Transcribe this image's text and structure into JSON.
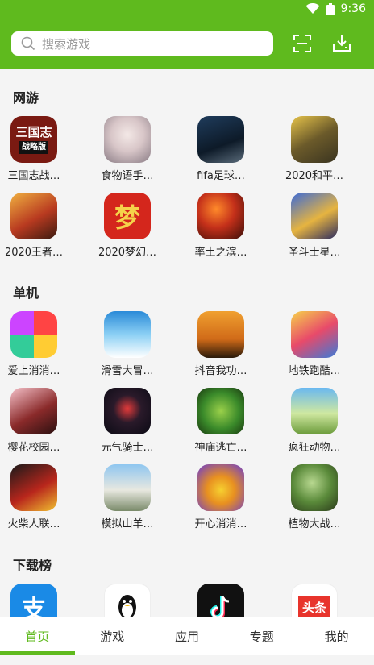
{
  "status": {
    "time": "9:36"
  },
  "search": {
    "placeholder": "搜索游戏"
  },
  "sections": {
    "online": {
      "title": "网游",
      "apps": [
        "三国志战…",
        "食物语手…",
        "fifa足球…",
        "2020和平…",
        "2020王者…",
        "2020梦幻…",
        "率土之滨…",
        "圣斗士星…"
      ]
    },
    "single": {
      "title": "单机",
      "apps": [
        "爱上消消…",
        "滑雪大冒…",
        "抖音我功…",
        "地铁跑酷…",
        "樱花校园…",
        "元气骑士…",
        "神庙逃亡…",
        "疯狂动物…",
        "火柴人联…",
        "模拟山羊…",
        "开心消消…",
        "植物大战…"
      ]
    },
    "ranking": {
      "title": "下载榜"
    }
  },
  "icon_text": {
    "sanguo": "三国志",
    "sanguo_sub": "战略版",
    "menghuan": "梦",
    "alipay": "支",
    "toutiao": "头条"
  },
  "tabs": [
    "首页",
    "游戏",
    "应用",
    "专题",
    "我的"
  ],
  "colors": {
    "brand": "#5fba1e"
  }
}
